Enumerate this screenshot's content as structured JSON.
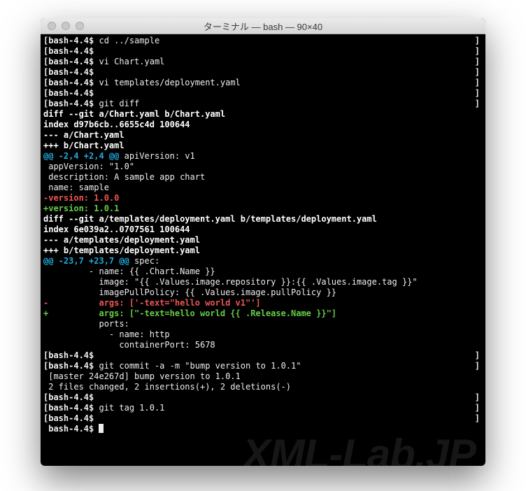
{
  "window": {
    "title": "ターミナル — bash — 90×40"
  },
  "watermark": "XML-Lab.JP",
  "lines": [
    {
      "t": "prompt",
      "ps1": "bash-4.4",
      "cmd": "cd ../sample",
      "endbr": true
    },
    {
      "t": "prompt",
      "ps1": "bash-4.4",
      "cmd": "",
      "endbr": true
    },
    {
      "t": "prompt",
      "ps1": "bash-4.4",
      "cmd": "vi Chart.yaml",
      "endbr": true
    },
    {
      "t": "prompt",
      "ps1": "bash-4.4",
      "cmd": "",
      "endbr": true
    },
    {
      "t": "prompt",
      "ps1": "bash-4.4",
      "cmd": "vi templates/deployment.yaml",
      "endbr": true
    },
    {
      "t": "prompt",
      "ps1": "bash-4.4",
      "cmd": "",
      "endbr": true
    },
    {
      "t": "prompt",
      "ps1": "bash-4.4",
      "cmd": "git diff",
      "endbr": true
    },
    {
      "t": "bold",
      "text": "diff --git a/Chart.yaml b/Chart.yaml"
    },
    {
      "t": "bold",
      "text": "index d97b6cb..6655c4d 100644"
    },
    {
      "t": "bold",
      "text": "--- a/Chart.yaml"
    },
    {
      "t": "bold",
      "text": "+++ b/Chart.yaml"
    },
    {
      "t": "hunk",
      "hunk": "@@ -2,4 +2,4 @@",
      "tail": " apiVersion: v1"
    },
    {
      "t": "ctx",
      "text": " appVersion: \"1.0\""
    },
    {
      "t": "ctx",
      "text": " description: A sample app chart"
    },
    {
      "t": "ctx",
      "text": " name: sample"
    },
    {
      "t": "del",
      "text": "-version: 1.0.0"
    },
    {
      "t": "add",
      "text": "+version: 1.0.1"
    },
    {
      "t": "bold",
      "text": "diff --git a/templates/deployment.yaml b/templates/deployment.yaml"
    },
    {
      "t": "bold",
      "text": "index 6e039a2..0707561 100644"
    },
    {
      "t": "bold",
      "text": "--- a/templates/deployment.yaml"
    },
    {
      "t": "bold",
      "text": "+++ b/templates/deployment.yaml"
    },
    {
      "t": "hunk",
      "hunk": "@@ -23,7 +23,7 @@",
      "tail": " spec:"
    },
    {
      "t": "ctx",
      "text": "         - name: {{ .Chart.Name }}"
    },
    {
      "t": "ctx",
      "text": "           image: \"{{ .Values.image.repository }}:{{ .Values.image.tag }}\""
    },
    {
      "t": "ctx",
      "text": "           imagePullPolicy: {{ .Values.image.pullPolicy }}"
    },
    {
      "t": "del",
      "text": "-          args: ['-text=\"hello world v1\"']"
    },
    {
      "t": "add",
      "text": "+          args: [\"-text=hello world {{ .Release.Name }}\"]"
    },
    {
      "t": "ctx",
      "text": "           ports:"
    },
    {
      "t": "ctx",
      "text": "             - name: http"
    },
    {
      "t": "ctx",
      "text": "               containerPort: 5678"
    },
    {
      "t": "prompt",
      "ps1": "bash-4.4",
      "cmd": "",
      "endbr": true
    },
    {
      "t": "prompt",
      "ps1": "bash-4.4",
      "cmd": "git commit -a -m \"bump version to 1.0.1\"",
      "endbr": true
    },
    {
      "t": "ctx",
      "text": " [master 24e267d] bump version to 1.0.1"
    },
    {
      "t": "ctx",
      "text": " 2 files changed, 2 insertions(+), 2 deletions(-)"
    },
    {
      "t": "prompt",
      "ps1": "bash-4.4",
      "cmd": "",
      "endbr": true
    },
    {
      "t": "prompt",
      "ps1": "bash-4.4",
      "cmd": "git tag 1.0.1",
      "endbr": true
    },
    {
      "t": "prompt",
      "ps1": "bash-4.4",
      "cmd": "",
      "endbr": true
    },
    {
      "t": "prompt",
      "ps1": "bash-4.4",
      "cmd": "",
      "nolead": true,
      "cursor": true
    }
  ]
}
